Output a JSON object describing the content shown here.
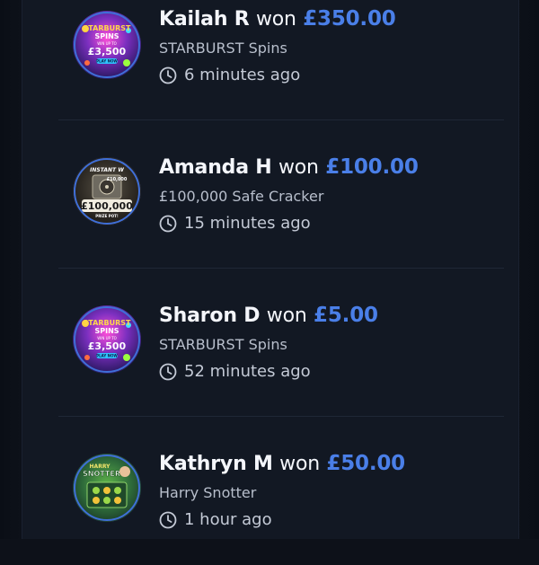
{
  "winners": [
    {
      "name": "Kailah R",
      "won_word": "won",
      "amount": "£350.00",
      "game": "STARBURST Spins",
      "time": "6 minutes ago",
      "thumb": {
        "icon": "starburst-spins-thumbnail",
        "line1": "STARBURST",
        "line2": "SPINS",
        "line3": "WIN UP TO",
        "prize": "£3,500",
        "button": "PLAY NOW"
      }
    },
    {
      "name": "Amanda H",
      "won_word": "won",
      "amount": "£100.00",
      "game": "£100,000 Safe Cracker",
      "time": "15 minutes ago",
      "thumb": {
        "icon": "safe-cracker-thumbnail",
        "line1": "INSTANT W",
        "safe": "£10,000",
        "prize": "£100,000",
        "line3": "PRIZE POT!"
      }
    },
    {
      "name": "Sharon D",
      "won_word": "won",
      "amount": "£5.00",
      "game": "STARBURST Spins",
      "time": "52 minutes ago",
      "thumb": {
        "icon": "starburst-spins-thumbnail",
        "line1": "STARBURST",
        "line2": "SPINS",
        "line3": "WIN UP TO",
        "prize": "£3,500",
        "button": "PLAY NOW"
      }
    },
    {
      "name": "Kathryn M",
      "won_word": "won",
      "amount": "£50.00",
      "game": "Harry Snotter",
      "time": "1 hour ago",
      "thumb": {
        "icon": "harry-snotter-thumbnail",
        "line1": "HARRY",
        "line2": "SNOTTER"
      }
    }
  ],
  "colors": {
    "amount": "#4a7fe8",
    "background": "#121823",
    "text": "#f4f6fb",
    "muted": "#b8bfcc"
  },
  "icons": {
    "time": "clock-icon"
  }
}
